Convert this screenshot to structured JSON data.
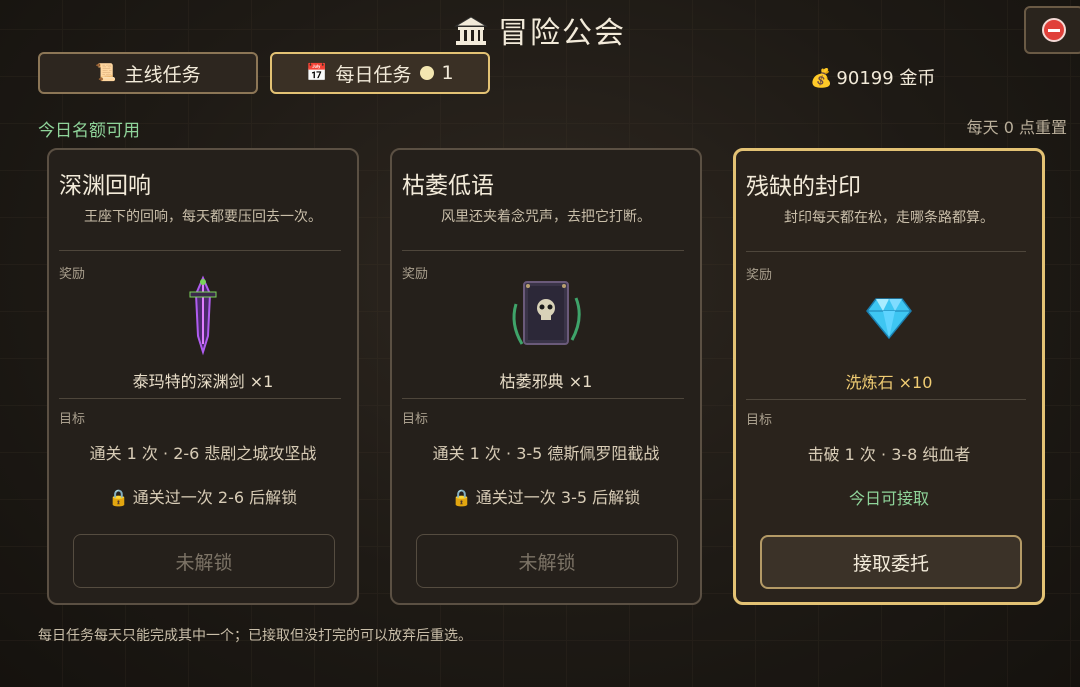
{
  "header": {
    "title": "冒险公会",
    "title_icon": "guild-hall-icon"
  },
  "tabs": [
    {
      "label": "主线任务",
      "icon": "scroll-icon"
    },
    {
      "label": "每日任务",
      "icon": "calendar-icon",
      "badge": "1"
    }
  ],
  "currency": {
    "amount": "90199",
    "unit": "金币",
    "icon": "money-bag-icon"
  },
  "quota_label": "今日名额可用",
  "reset_label": "每天 0 点重置",
  "cards": [
    {
      "title": "深渊回响",
      "desc": "王座下的回响，每天都要压回去一次。",
      "reward_section": "奖励",
      "reward_name": "泰玛特的深渊剑 ×1",
      "reward_icon": "abyss-sword-icon",
      "goal_section": "目标",
      "goal": "通关 1 次 · 2-6 悲剧之城攻坚战",
      "status": "通关过一次 2-6 后解锁",
      "button": "未解锁"
    },
    {
      "title": "枯萎低语",
      "desc": "风里还夹着念咒声，去把它打断。",
      "reward_section": "奖励",
      "reward_name": "枯萎邪典 ×1",
      "reward_icon": "withered-tome-icon",
      "goal_section": "目标",
      "goal": "通关 1 次 · 3-5 德斯佩罗阻截战",
      "status": "通关过一次 3-5 后解锁",
      "button": "未解锁"
    },
    {
      "title": "残缺的封印",
      "desc": "封印每天都在松，走哪条路都算。",
      "reward_section": "奖励",
      "reward_name": "洗炼石 ×10",
      "reward_icon": "diamond-icon",
      "goal_section": "目标",
      "goal": "击破 1 次 · 3-8 纯血者",
      "status": "今日可接取",
      "button": "接取委托"
    }
  ],
  "footer": "每日任务每天只能完成其中一个；已接取但没打完的可以放弃后重选。",
  "colors": {
    "accent": "#e3c274",
    "available": "#8fd49a",
    "reward_highlight": "#f0cc73"
  }
}
